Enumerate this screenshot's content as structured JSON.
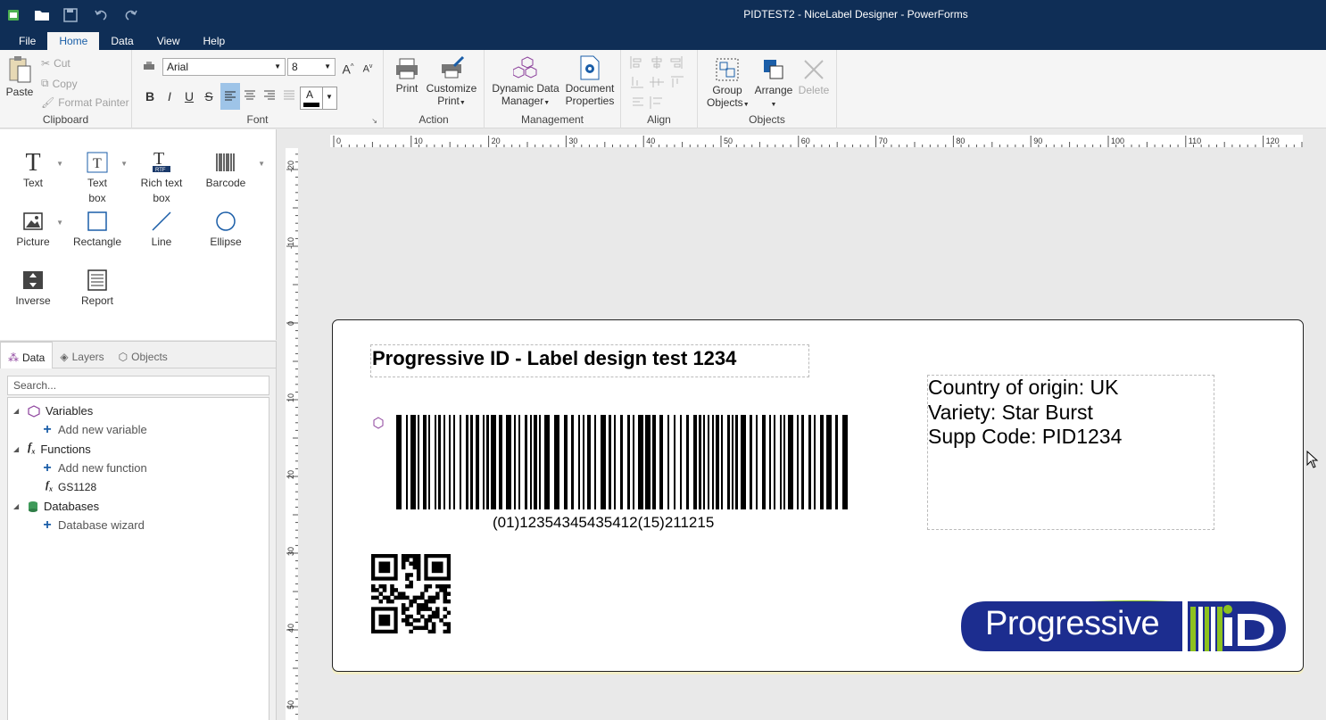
{
  "app": {
    "title": "PIDTEST2 - NiceLabel Designer - PowerForms",
    "menu_tabs": [
      "File",
      "Home",
      "Data",
      "View",
      "Help"
    ]
  },
  "ribbon": {
    "clipboard": {
      "paste": "Paste",
      "cut": "Cut",
      "copy": "Copy",
      "format_painter": "Format Painter",
      "label": "Clipboard"
    },
    "font": {
      "family": "Arial",
      "size": "8",
      "label": "Font"
    },
    "action": {
      "print": "Print",
      "customize_print_1": "Customize",
      "customize_print_2": "Print",
      "label": "Action"
    },
    "management": {
      "ddm_1": "Dynamic Data",
      "ddm_2": "Manager",
      "docprops_1": "Document",
      "docprops_2": "Properties",
      "label": "Management"
    },
    "align": {
      "label": "Align"
    },
    "objects": {
      "group_1": "Group",
      "group_2": "Objects",
      "arrange": "Arrange",
      "delete": "Delete",
      "label": "Objects"
    }
  },
  "toolbox": {
    "text": "Text",
    "textbox_1": "Text",
    "textbox_2": "box",
    "richtext_1": "Rich text",
    "richtext_2": "box",
    "barcode": "Barcode",
    "picture": "Picture",
    "rectangle": "Rectangle",
    "line": "Line",
    "ellipse": "Ellipse",
    "inverse": "Inverse",
    "report": "Report"
  },
  "panel": {
    "tabs": [
      "Data",
      "Layers",
      "Objects"
    ],
    "search_placeholder": "Search...",
    "tree": {
      "variables": "Variables",
      "add_variable": "Add new variable",
      "functions": "Functions",
      "add_function": "Add new function",
      "gs1128": "GS1128",
      "databases": "Databases",
      "db_wizard": "Database wizard"
    }
  },
  "ruler": {
    "h_labels": [
      "0",
      "10",
      "20",
      "30",
      "40",
      "50",
      "60",
      "70",
      "80",
      "90",
      "100",
      "110",
      "120"
    ],
    "v_labels": [
      "-20",
      "-10",
      "0",
      "10",
      "20",
      "30",
      "40",
      "50"
    ]
  },
  "label": {
    "title": "Progressive ID - Label design test 1234",
    "country_lines": [
      "Country of origin: UK",
      "Variety: Star Burst",
      "Supp Code: PID1234"
    ],
    "barcode_text": "(01)12354345435412(15)211215",
    "logo_text": "Progressive",
    "colors": {
      "logo_blue": "#1c2d8f",
      "logo_green": "#8dc21f"
    }
  }
}
